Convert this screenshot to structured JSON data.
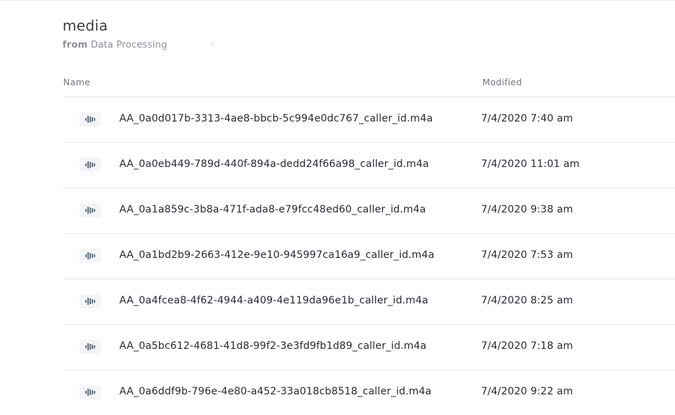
{
  "header": {
    "title": "media",
    "subtitle_from": "from",
    "subtitle_source": "Data Processing"
  },
  "columns": {
    "name": "Name",
    "modified": "Modified"
  },
  "files": [
    {
      "name": "AA_0a0d017b-3313-4ae8-bbcb-5c994e0dc767_caller_id.m4a",
      "modified": "7/4/2020 7:40 am",
      "icon": "audio-waveform-icon"
    },
    {
      "name": "AA_0a0eb449-789d-440f-894a-dedd24f66a98_caller_id.m4a",
      "modified": "7/4/2020 11:01 am",
      "icon": "audio-waveform-icon"
    },
    {
      "name": "AA_0a1a859c-3b8a-471f-ada8-e79fcc48ed60_caller_id.m4a",
      "modified": "7/4/2020 9:38 am",
      "icon": "audio-waveform-icon"
    },
    {
      "name": "AA_0a1bd2b9-2663-412e-9e10-945997ca16a9_caller_id.m4a",
      "modified": "7/4/2020 7:53 am",
      "icon": "audio-waveform-icon"
    },
    {
      "name": "AA_0a4fcea8-4f62-4944-a409-4e119da96e1b_caller_id.m4a",
      "modified": "7/4/2020 8:25 am",
      "icon": "audio-waveform-icon"
    },
    {
      "name": "AA_0a5bc612-4681-41d8-99f2-3e3fd9fb1d89_caller_id.m4a",
      "modified": "7/4/2020 7:18 am",
      "icon": "audio-waveform-icon"
    },
    {
      "name": "AA_0a6ddf9b-796e-4e80-a452-33a018cb8518_caller_id.m4a",
      "modified": "7/4/2020 9:22 am",
      "icon": "audio-waveform-icon"
    }
  ]
}
